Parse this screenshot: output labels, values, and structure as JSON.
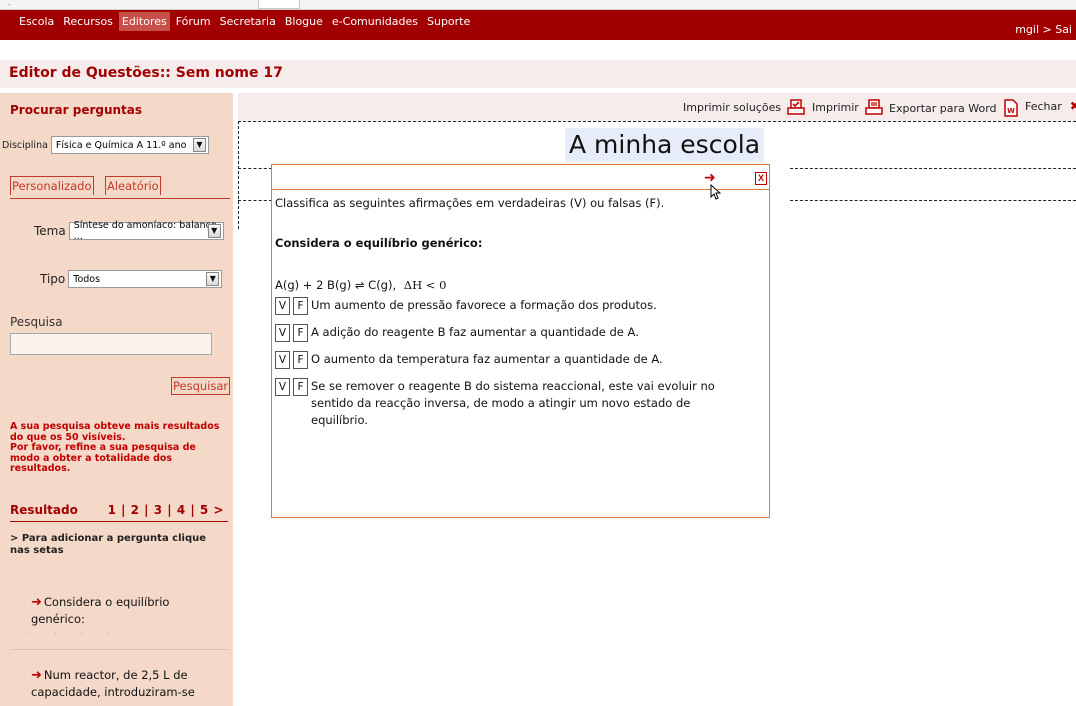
{
  "nav": {
    "items": [
      "Escola",
      "Recursos",
      "Editores",
      "Fórum",
      "Secretaria",
      "Blogue",
      "e-Comunidades",
      "Suporte"
    ],
    "active_index": 2,
    "user": "mgil > Sai",
    "bar_color": "#a20000"
  },
  "page": {
    "title": "Editor de Questões:: Sem nome 17"
  },
  "sidebar": {
    "heading": "Procurar perguntas",
    "disciplina_label": "Disciplina",
    "disciplina_value": "Física e Química A 11.º ano",
    "tab_personalizado": "Personalizado",
    "tab_aleatorio": "Aleatório",
    "tema_label": "Tema",
    "tema_value": "Síntese do amoníaco: balanço ...",
    "tipo_label": "Tipo",
    "tipo_value": "Todos",
    "pesquisa_label": "Pesquisa",
    "pesquisa_value": "",
    "pesquisar_button": "Pesquisar",
    "warning": "A sua pesquisa obteve mais resultados do que os 50 visíveis.\nPor favor, refine a sua pesquisa de modo a obter a totalidade dos resultados.",
    "result_label": "Resultado",
    "pages": "1 | 2 | 3 | 4 | 5 >",
    "hint": "> Para adicionar a pergunta clique nas setas",
    "results": [
      "Considera o equilíbrio genérico:",
      "Num reactor, de 2,5 L de capacidade, introduziram-se"
    ]
  },
  "toolbar": {
    "print_solutions": "Imprimir soluções",
    "print": "Imprimir",
    "export_word": "Exportar para Word",
    "close": "Fechar"
  },
  "main": {
    "school_title": "A minha escola"
  },
  "popup": {
    "instruction": "Classifica as seguintes afirmações em verdadeiras (V) ou falsas (F).",
    "consider": "Considera o equilíbrio genérico:",
    "equation": "A(g) + 2 B(g)  ⇌  C(g),",
    "equation_delta": "ΔH < 0",
    "v_label": "V",
    "f_label": "F",
    "statements": [
      "Um aumento de pressão favorece a formação dos produtos.",
      "A adição do reagente B faz aumentar a quantidade de A.",
      "O aumento da temperatura faz aumentar a quantidade de A.",
      "Se se remover o reagente B do sistema reaccional, este vai evoluir no sentido da reacção inversa, de modo a atingir um novo estado de equilíbrio."
    ]
  }
}
